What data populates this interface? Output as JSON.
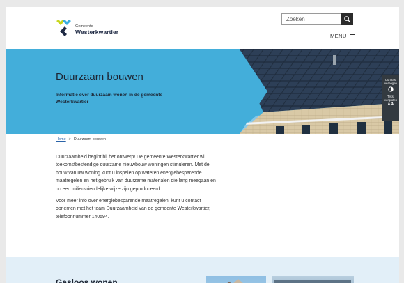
{
  "header": {
    "logo": {
      "gemeente": "Gemeente",
      "name": "Westerkwartier"
    },
    "search": {
      "placeholder": "Zoeken"
    },
    "menu_label": "MENU"
  },
  "hero": {
    "title": "Duurzaam bouwen",
    "subtitle": "Informatie over duurzaam wonen in de gemeente Westerkwartier"
  },
  "accessibility": {
    "contrast_label": "Contrast verhogen",
    "text_label": "Tekst vergroten",
    "text_glyph": "A"
  },
  "breadcrumb": {
    "home": "Home",
    "separator": ">",
    "current": "Duurzaam bouwen"
  },
  "content": {
    "p1": "Duurzaamheid begint bij het ontwerp! De gemeente Westerkwartier wil toekomstbestendige duurzame nieuwbouw woningen stimuleren. Met de bouw van uw woning kunt u inspelen op wateren energiebesparende maatregelen en het gebruik van duurzame materialen die lang meegaan en op een milieuvriendelijke wijze zijn geproduceerd.",
    "p2": "Voor meer info over energiebesparende maatregelen, kunt u contact opnemen met het team Duurzaamheid van de gemeente Westerkwartier, telefoonnummer 140594."
  },
  "band": {
    "title": "Gasloos wonen"
  },
  "colors": {
    "hero_blue": "#43aeda",
    "logo_yellow": "#c8d61e",
    "logo_blue": "#3aaee0",
    "logo_dark": "#1f2a44"
  }
}
